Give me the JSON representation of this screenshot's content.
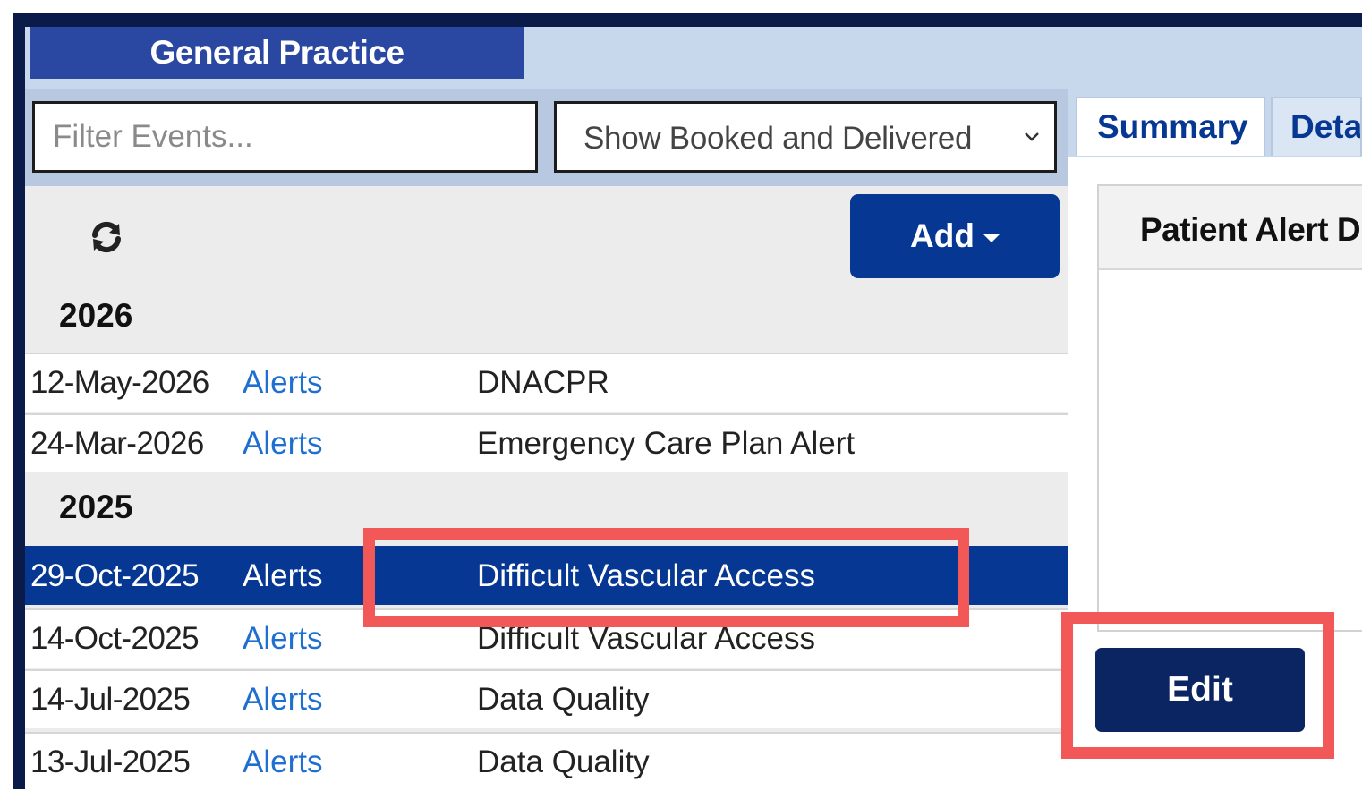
{
  "header": {
    "practice_tab": "General Practice"
  },
  "filter": {
    "placeholder": "Filter Events...",
    "selected_option": "Show Booked and Delivered"
  },
  "toolbar": {
    "add_label": "Add"
  },
  "timeline": {
    "years": [
      "2026",
      "2025"
    ],
    "rows": [
      {
        "date": "12-May-2026",
        "type": "Alerts",
        "title": "DNACPR"
      },
      {
        "date": "24-Mar-2026",
        "type": "Alerts",
        "title": "Emergency Care Plan Alert"
      },
      {
        "date": "29-Oct-2025",
        "type": "Alerts",
        "title": "Difficult Vascular Access",
        "selected": true
      },
      {
        "date": "14-Oct-2025",
        "type": "Alerts",
        "title": "Difficult Vascular Access"
      },
      {
        "date": "14-Jul-2025",
        "type": "Alerts",
        "title": "Data Quality"
      },
      {
        "date": "13-Jul-2025",
        "type": "Alerts",
        "title": "Data Quality"
      }
    ]
  },
  "detail": {
    "tabs": [
      "Summary",
      "Deta"
    ],
    "panel_heading": "Patient Alert D",
    "edit_label": "Edit"
  },
  "colors": {
    "brand_blue": "#063793",
    "tab_blue": "#2a48a2",
    "link_blue": "#1f6fd1",
    "highlight_red": "#f25858"
  }
}
